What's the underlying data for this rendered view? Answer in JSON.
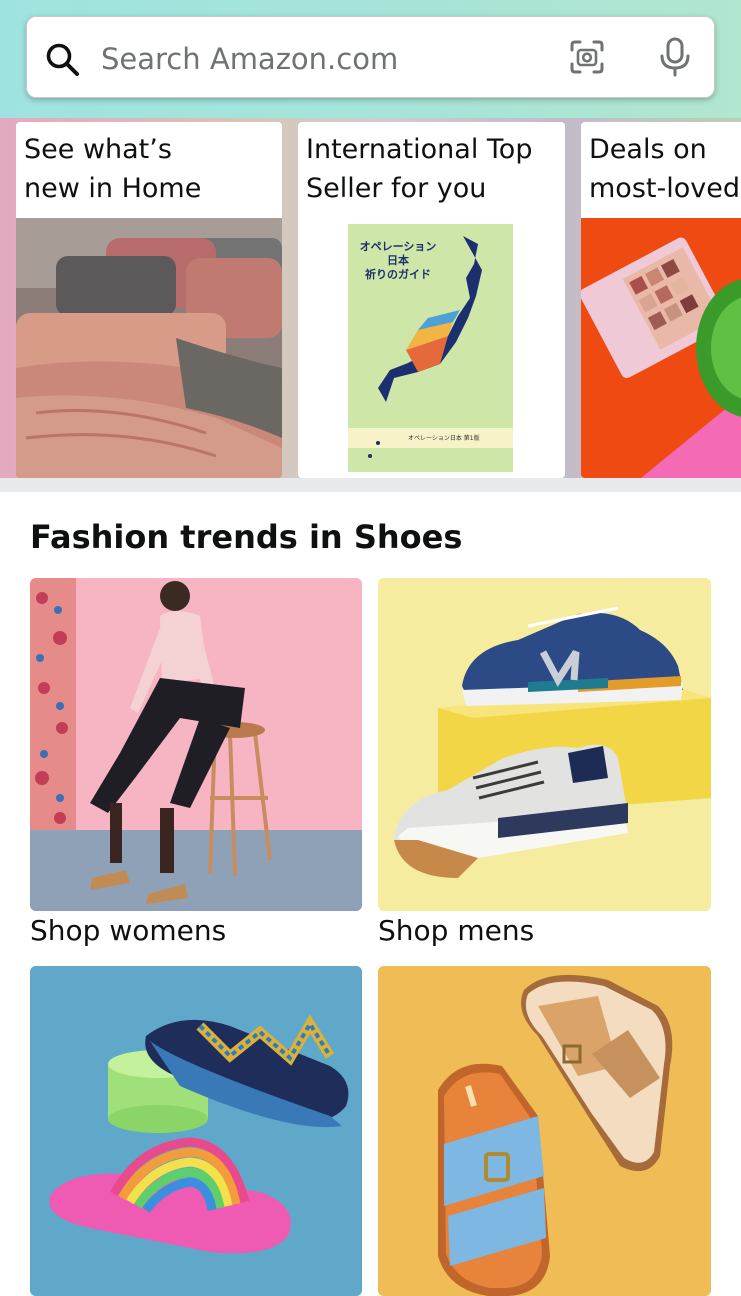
{
  "search": {
    "placeholder": "Search Amazon.com",
    "icon": "search-icon",
    "camera_icon": "camera-icon",
    "mic_icon": "microphone-icon"
  },
  "cards": [
    {
      "title_line1": "See what’s",
      "title_line2": "new in Home"
    },
    {
      "title_line1": "International Top",
      "title_line2": "Seller for you",
      "book_title": [
        "オペレーション",
        "日本",
        "祈りのガイド"
      ],
      "book_footer": "オペレーション日本 第1版"
    },
    {
      "title_line1": "Deals on",
      "title_line2": "most-loved"
    }
  ],
  "fashion": {
    "title": "Fashion trends in Shoes",
    "tiles": [
      {
        "label": "Shop womens"
      },
      {
        "label": "Shop mens"
      },
      {
        "label": ""
      },
      {
        "label": ""
      }
    ]
  },
  "colors": {
    "header_gradient_start": "#9fe3e0",
    "header_gradient_end": "#b1e6cf",
    "text": "#0f1111",
    "placeholder": "#6f7373"
  }
}
